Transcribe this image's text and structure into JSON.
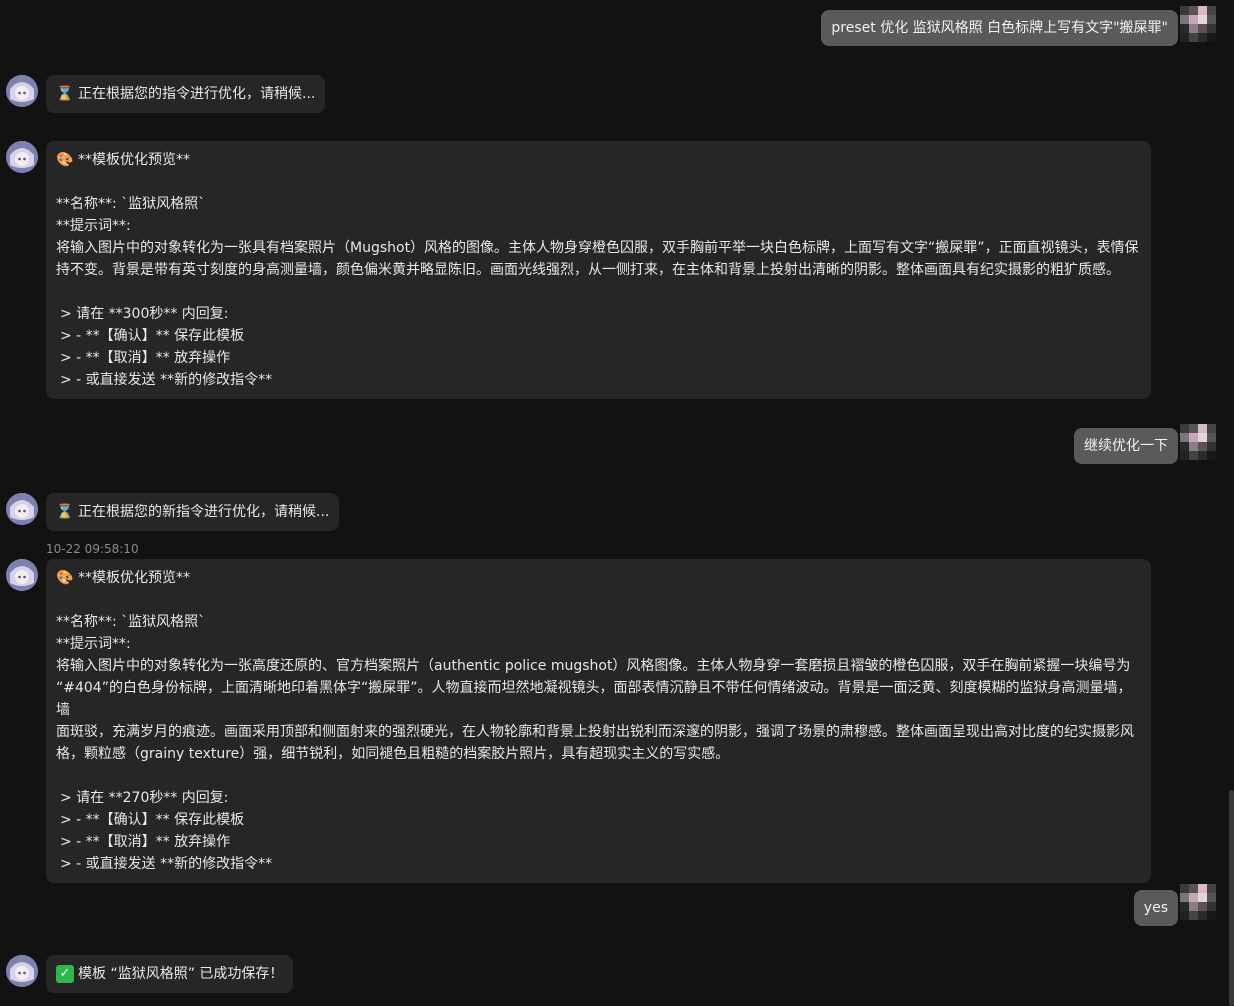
{
  "messages": [
    {
      "role": "user",
      "text": "preset 优化 监狱风格照 白色标牌上写有文字\"搬屎罪\""
    },
    {
      "role": "bot",
      "icon": "hourglass-icon",
      "text": "正在根据您的指令进行优化，请稍候..."
    },
    {
      "role": "bot",
      "card": {
        "header_icon": "palette-icon",
        "header": "**模板优化预览**",
        "name_line": "**名称**: `监狱风格照`",
        "prompt_label": "**提示词**:",
        "prompt_lines": [
          "将输入图片中的对象转化为一张具有档案照片（Mugshot）风格的图像。主体人物身穿橙色囚服，双手胸前平举一块白色标牌，上面写有文字“搬屎罪”，正面直视镜头，表情保",
          "持不变。背景是带有英寸刻度的身高测量墙，颜色偏米黄并略显陈旧。画面光线强烈，从一侧打来，在主体和背景上投射出清晰的阴影。整体画面具有纪实摄影的粗犷质感。"
        ],
        "quote_lines": [
          "> 请在 **300秒** 内回复:",
          "> - **【确认】** 保存此模板",
          "> - **【取消】** 放弃操作",
          "> - 或直接发送 **新的修改指令**"
        ]
      }
    },
    {
      "role": "user",
      "text": "继续优化一下"
    },
    {
      "role": "bot",
      "icon": "hourglass-icon",
      "text": "正在根据您的新指令进行优化，请稍候..."
    },
    {
      "role": "bot",
      "timestamp": "10-22 09:58:10",
      "card": {
        "header_icon": "palette-icon",
        "header": "**模板优化预览**",
        "name_line": "**名称**: `监狱风格照`",
        "prompt_label": "**提示词**:",
        "prompt_lines": [
          "将输入图片中的对象转化为一张高度还原的、官方档案照片（authentic police mugshot）风格图像。主体人物身穿一套磨损且褶皱的橙色囚服，双手在胸前紧握一块编号为",
          "“#404”的白色身份标牌，上面清晰地印着黑体字“搬屎罪”。人物直接而坦然地凝视镜头，面部表情沉静且不带任何情绪波动。背景是一面泛黄、刻度模糊的监狱身高测量墙，墙",
          "面斑驳，充满岁月的痕迹。画面采用顶部和侧面射来的强烈硬光，在人物轮廓和背景上投射出锐利而深邃的阴影，强调了场景的肃穆感。整体画面呈现出高对比度的纪实摄影风",
          "格，颗粒感（grainy texture）强，细节锐利，如同褪色且粗糙的档案胶片照片，具有超现实主义的写实感。"
        ],
        "quote_lines": [
          "> 请在 **270秒** 内回复:",
          "> - **【确认】** 保存此模板",
          "> - **【取消】** 放弃操作",
          "> - 或直接发送 **新的修改指令**"
        ]
      }
    },
    {
      "role": "user",
      "text": "yes"
    },
    {
      "role": "bot",
      "icon": "check-mark-icon",
      "text": "模板 “监狱风格照” 已成功保存！"
    }
  ],
  "colors": {
    "background": "#121212",
    "user_bubble": "#5a5a5a",
    "bot_bubble": "#262626",
    "check_green": "#2eb84b"
  }
}
